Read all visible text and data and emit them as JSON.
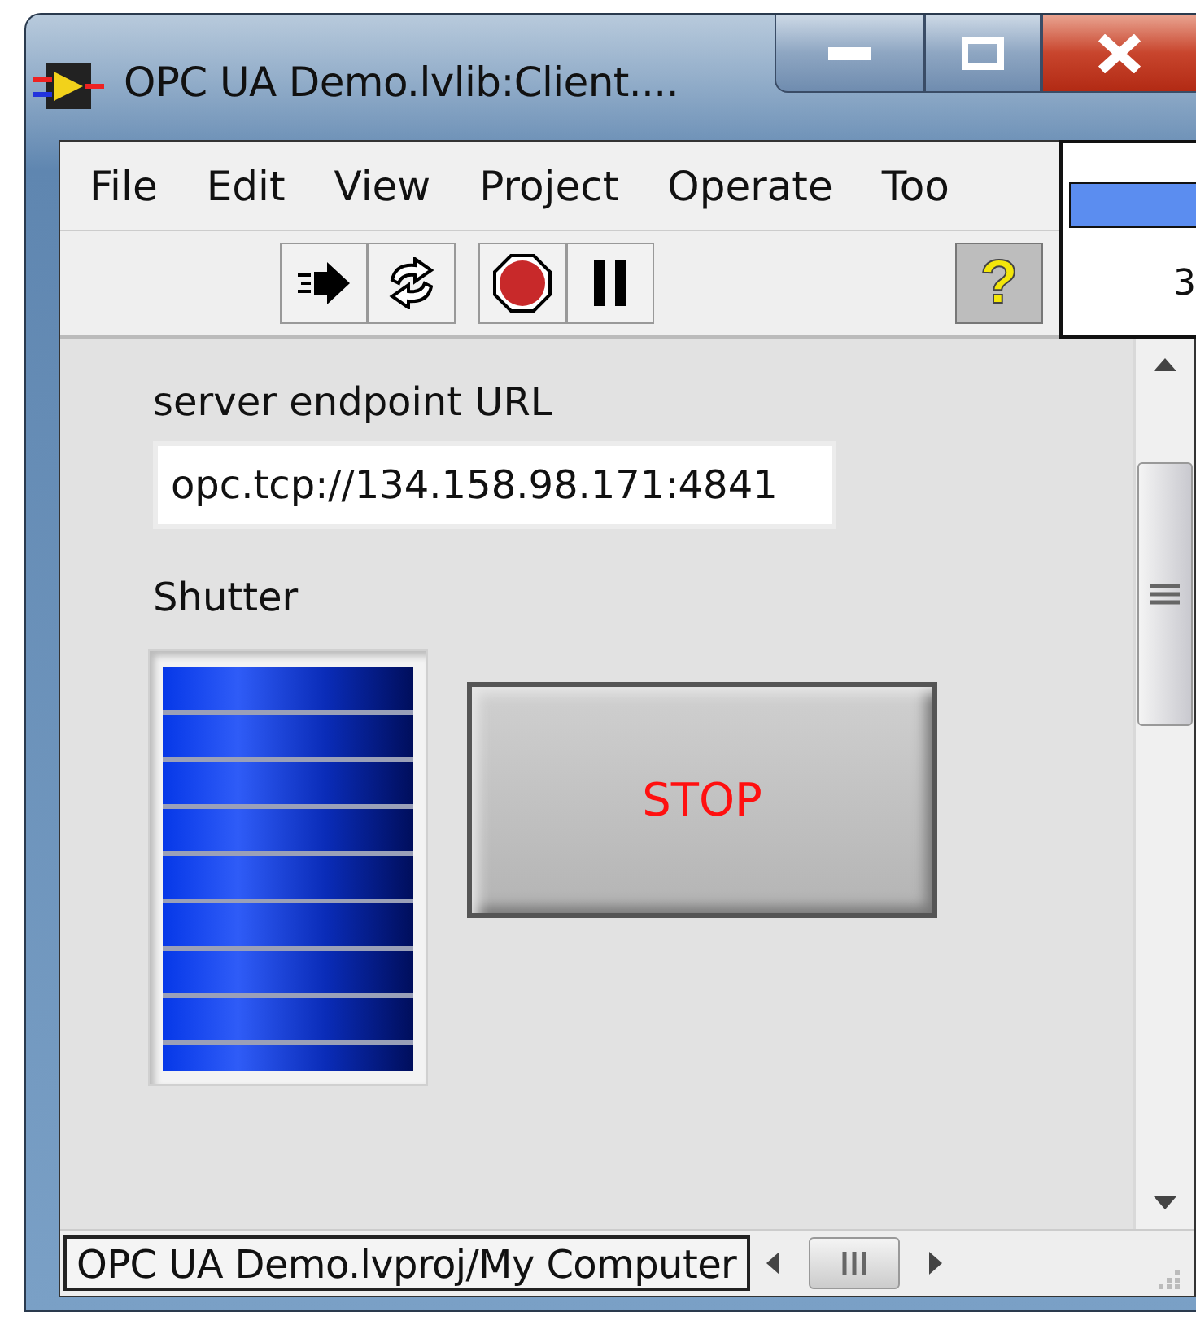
{
  "window": {
    "title": "OPC UA Demo.lvlib:Client...."
  },
  "menu": [
    {
      "label": "File"
    },
    {
      "label": "Edit"
    },
    {
      "label": "View"
    },
    {
      "label": "Project"
    },
    {
      "label": "Operate"
    },
    {
      "label": "Too"
    }
  ],
  "toolbar": {
    "help_button": {
      "label": "?",
      "on": true
    }
  },
  "side_window": {
    "cell": "3"
  },
  "panel": {
    "url_label": "server endpoint URL",
    "url_value": "opc.tcp://134.158.98.171:4841",
    "shutter_label": "Shutter",
    "stop_button": {
      "label": "STOP"
    }
  },
  "status_bar": {
    "project_path": "OPC UA Demo.lvproj/My Computer"
  }
}
